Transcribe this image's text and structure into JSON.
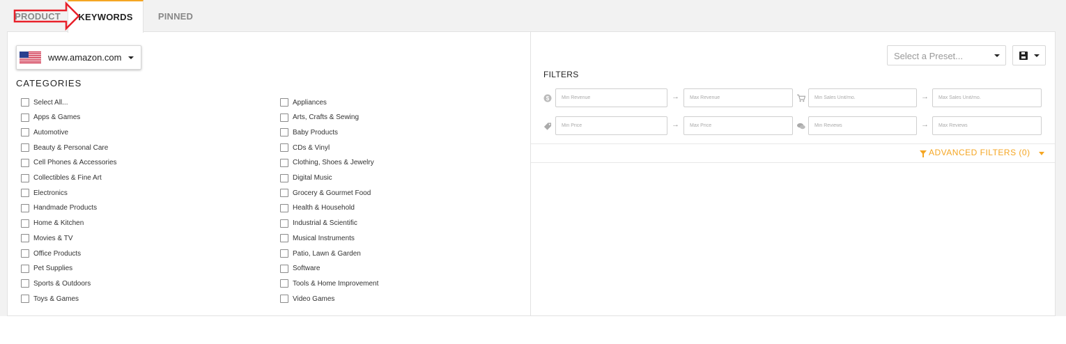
{
  "tabs": [
    {
      "label": "PRODUCT"
    },
    {
      "label": "KEYWORDS"
    },
    {
      "label": "PINNED"
    }
  ],
  "marketplace": {
    "label": "www.amazon.com",
    "flag": "us-flag-icon"
  },
  "categories": {
    "title": "CATEGORIES",
    "left": [
      "Select All...",
      "Apps & Games",
      "Automotive",
      "Beauty & Personal Care",
      "Cell Phones & Accessories",
      "Collectibles & Fine Art",
      "Electronics",
      "Handmade Products",
      "Home & Kitchen",
      "Movies & TV",
      "Office Products",
      "Pet Supplies",
      "Sports & Outdoors",
      "Toys & Games"
    ],
    "right": [
      "Appliances",
      "Arts, Crafts & Sewing",
      "Baby Products",
      "CDs & Vinyl",
      "Clothing, Shoes & Jewelry",
      "Digital Music",
      "Grocery & Gourmet Food",
      "Health & Household",
      "Industrial & Scientific",
      "Musical Instruments",
      "Patio, Lawn & Garden",
      "Software",
      "Tools & Home Improvement",
      "Video Games"
    ]
  },
  "preset": {
    "placeholder": "Select a Preset..."
  },
  "filters": {
    "title": "FILTERS",
    "min_revenue": "Min Revenue",
    "max_revenue": "Max Revenue",
    "min_sales": "Min Sales Unit/mo.",
    "max_sales": "Max Sales Unit/mo.",
    "min_price": "Min Price",
    "max_price": "Max Price",
    "min_reviews": "Min Reviews",
    "max_reviews": "Max Reviews"
  },
  "advanced_filters": {
    "label": "ADVANCED FILTERS (0)"
  },
  "colors": {
    "accent": "#f5a623",
    "annotation": "#e8202a"
  }
}
